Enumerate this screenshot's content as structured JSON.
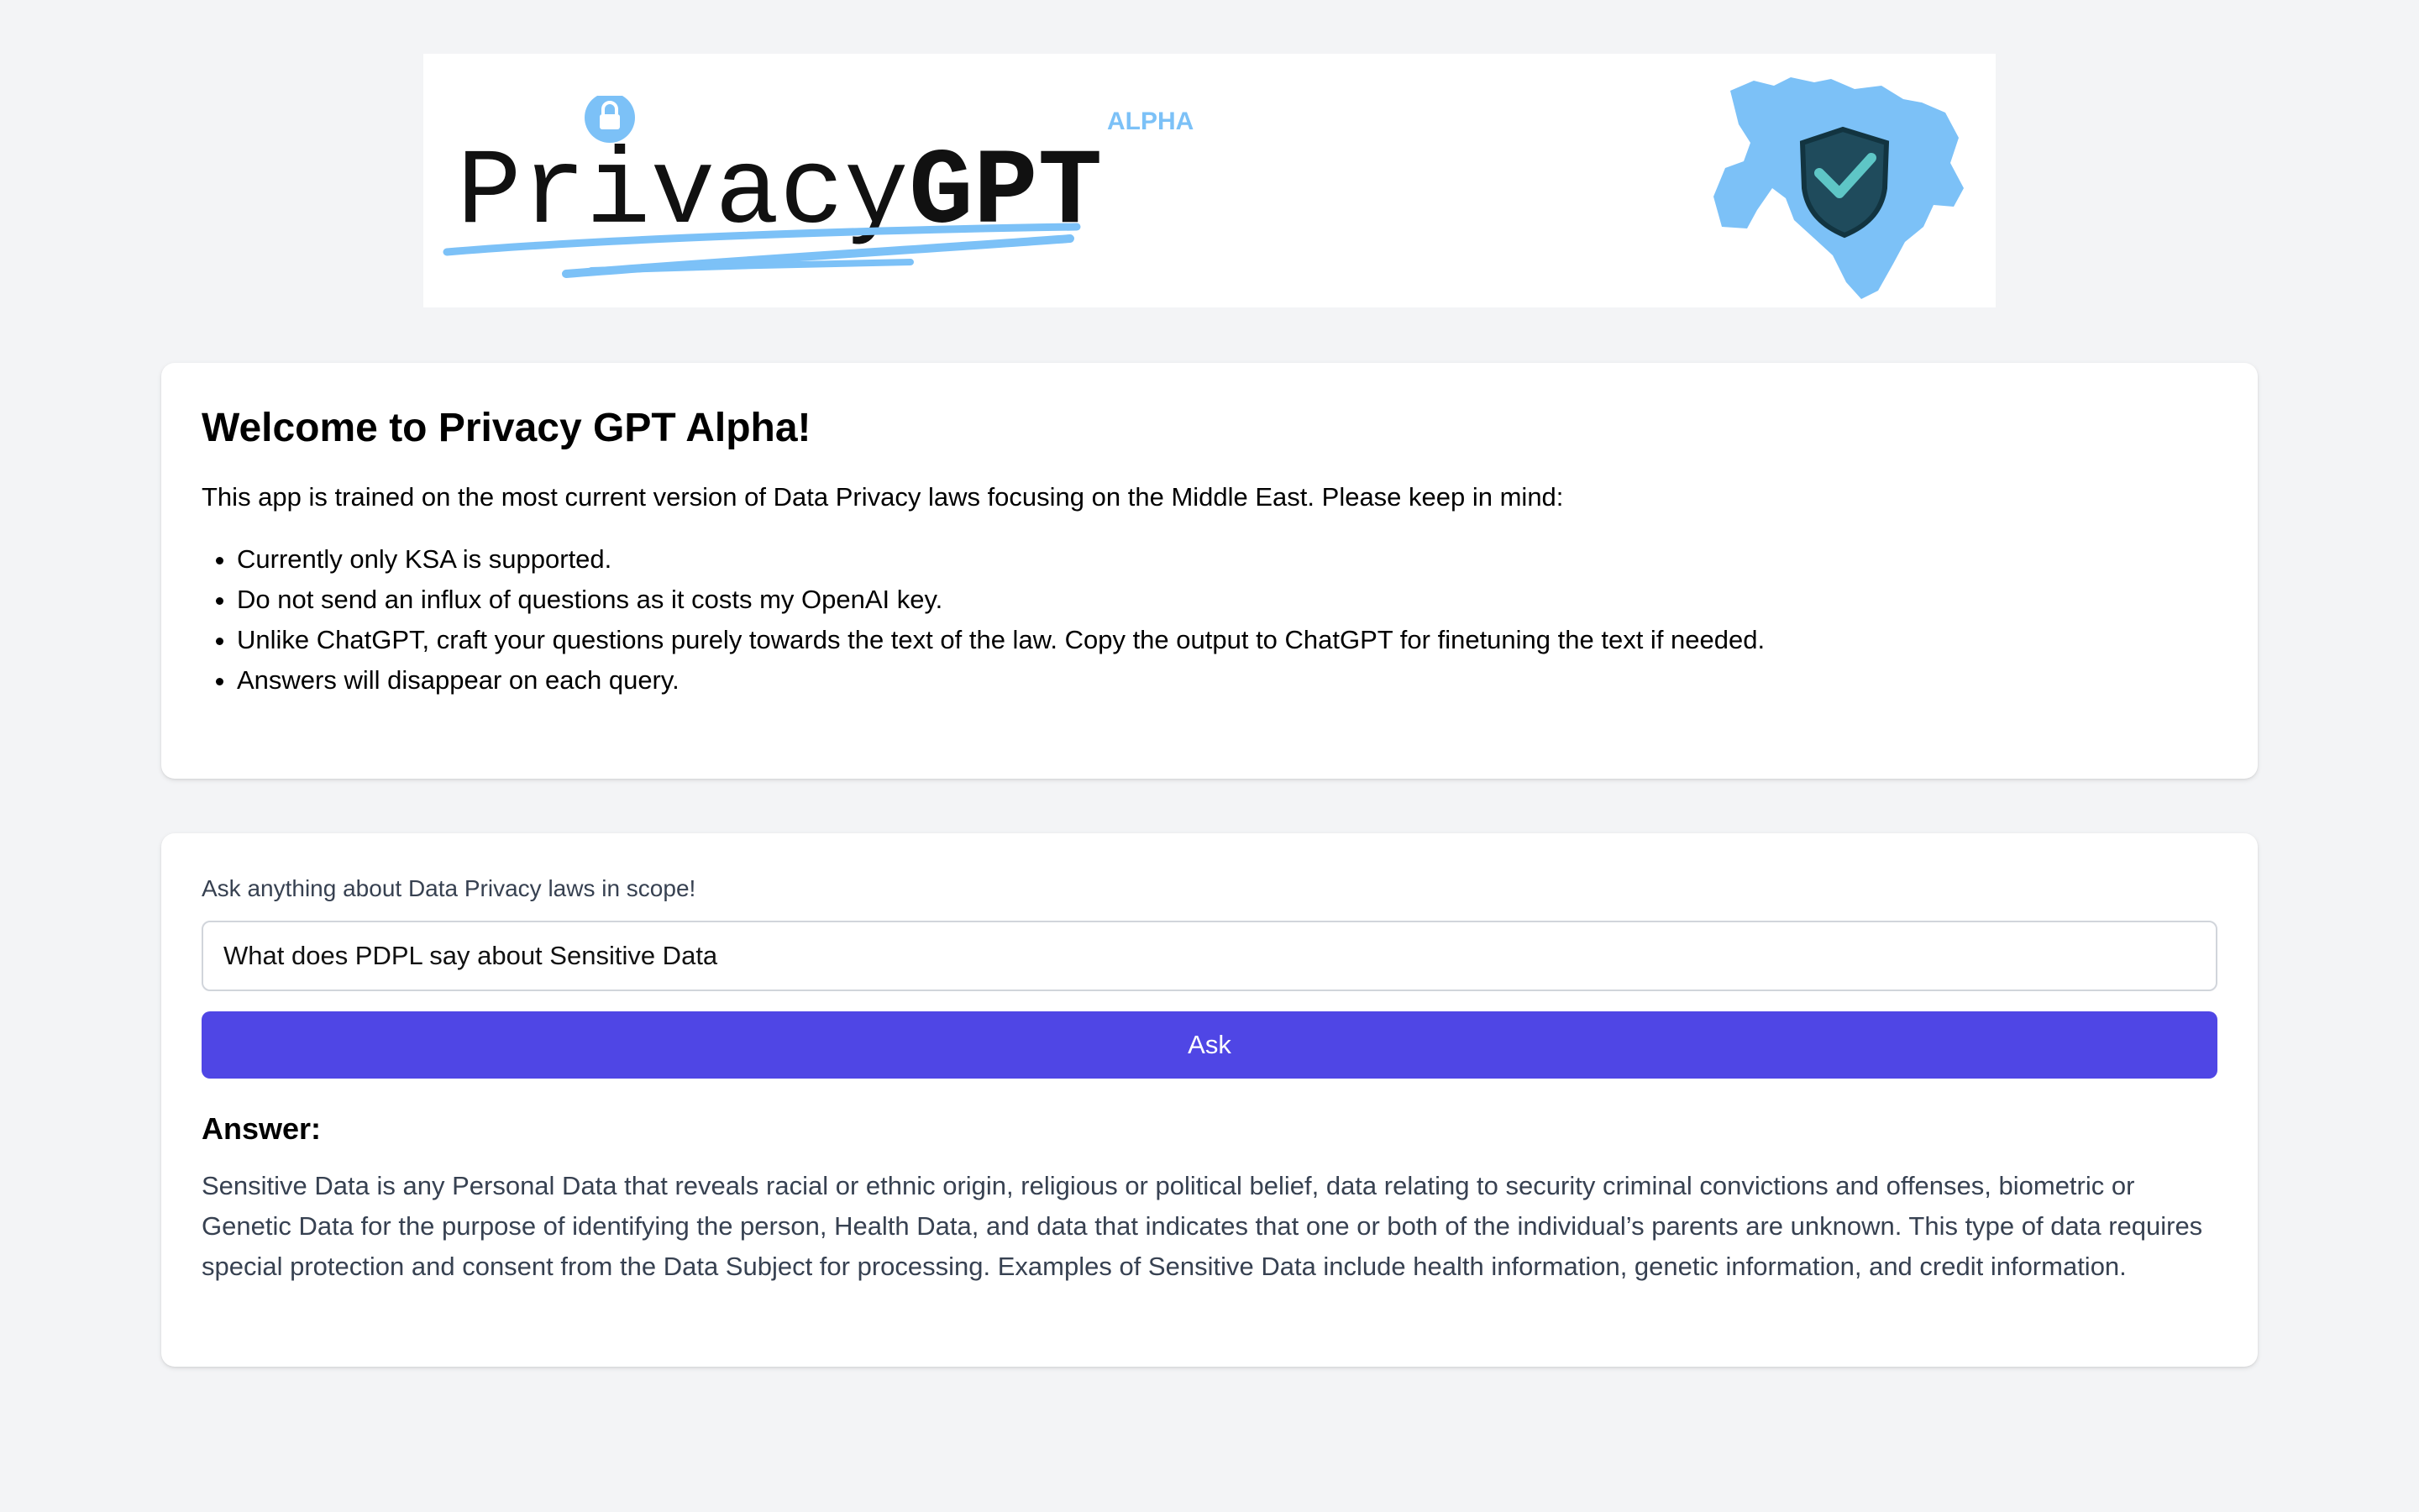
{
  "banner": {
    "logo_text_regular": "Privacy",
    "logo_text_bold": "GPT",
    "logo_badge": "ALPHA",
    "logo_icon": "lock-icon",
    "map_icon": "middle-east-shield-icon",
    "accent_color": "#7cc1f7"
  },
  "welcome": {
    "title": "Welcome to Privacy GPT Alpha!",
    "intro": "This app is trained on the most current version of Data Privacy laws focusing on the Middle East. Please keep in mind:",
    "rules": [
      "Currently only KSA is supported.",
      "Do not send an influx of questions as it costs my OpenAI key.",
      "Unlike ChatGPT, craft your questions purely towards the text of the law. Copy the output to ChatGPT for finetuning the text if needed.",
      "Answers will disappear on each query."
    ]
  },
  "ask": {
    "label": "Ask anything about Data Privacy laws in scope!",
    "query_value": "What does PDPL say about Sensitive Data",
    "button_label": "Ask",
    "button_color": "#4f46e5",
    "answer_heading": "Answer:",
    "answer_text": "Sensitive Data is any Personal Data that reveals racial or ethnic origin, religious or political belief, data relating to security criminal convictions and offenses, biometric or Genetic Data for the purpose of identifying the person, Health Data, and data that indicates that one or both of the individual’s parents are unknown. This type of data requires special protection and consent from the Data Subject for processing. Examples of Sensitive Data include health information, genetic information, and credit information."
  }
}
